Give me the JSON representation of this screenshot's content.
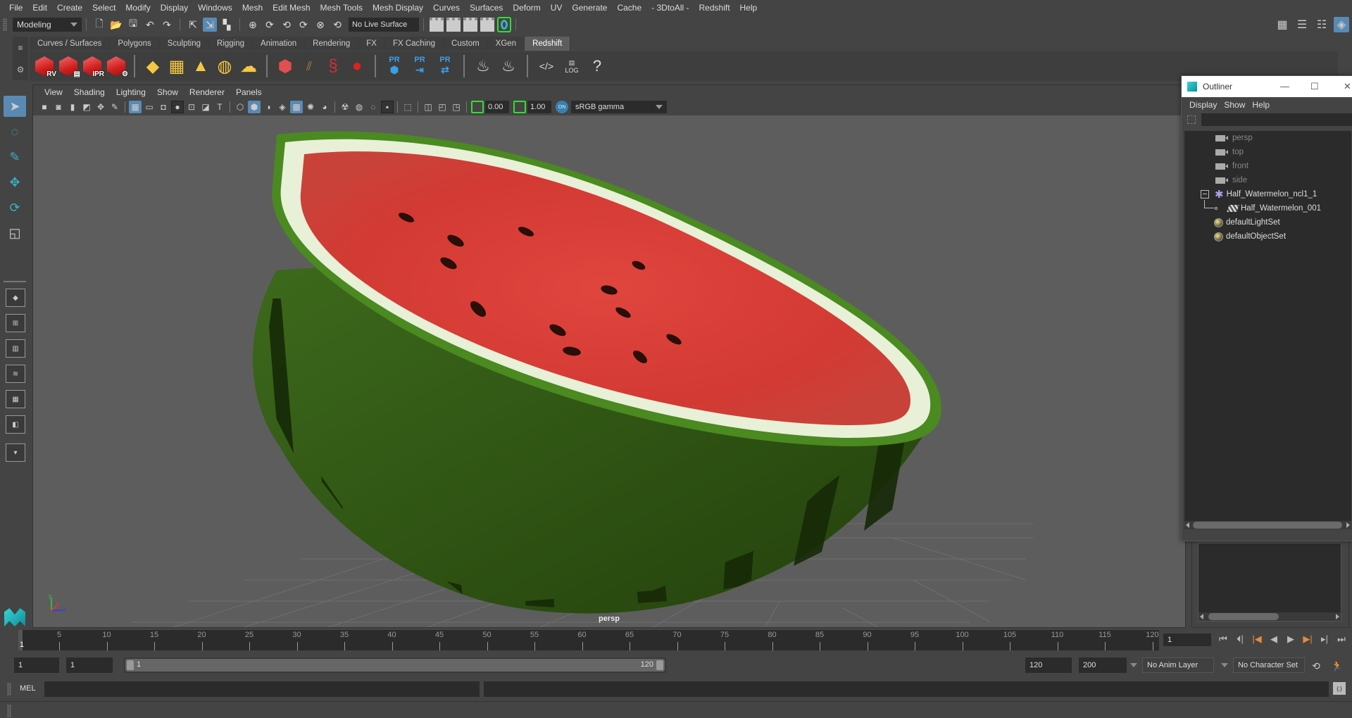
{
  "menubar": {
    "items": [
      "File",
      "Edit",
      "Create",
      "Select",
      "Modify",
      "Display",
      "Windows",
      "Mesh",
      "Edit Mesh",
      "Mesh Tools",
      "Mesh Display",
      "Curves",
      "Surfaces",
      "Deform",
      "UV",
      "Generate",
      "Cache",
      "- 3DtoAll -",
      "Redshift",
      "Help"
    ]
  },
  "statusline": {
    "mode": "Modeling",
    "live_surface": "No Live Surface"
  },
  "shelf": {
    "tabs": [
      "Curves / Surfaces",
      "Polygons",
      "Sculpting",
      "Rigging",
      "Animation",
      "Rendering",
      "FX",
      "FX Caching",
      "Custom",
      "XGen",
      "Redshift"
    ],
    "active_tab": "Redshift",
    "redshift_buttons": [
      "RV",
      "",
      "IPR",
      ""
    ],
    "pr_label": "PR",
    "log_label": "LOG",
    "help_glyph": "?"
  },
  "panel": {
    "menu": [
      "View",
      "Shading",
      "Lighting",
      "Show",
      "Renderer",
      "Panels"
    ],
    "exposure": "0.00",
    "gamma": "1.00",
    "color_space_toggle": "ON",
    "color_space": "sRGB gamma",
    "camera": "persp",
    "axis_labels": {
      "x": "x",
      "y": "y",
      "z": "z"
    }
  },
  "outliner": {
    "title": "Outliner",
    "menu": [
      "Display",
      "Show",
      "Help"
    ],
    "search_value": "",
    "items": [
      {
        "label": "persp",
        "type": "camera",
        "dim": true
      },
      {
        "label": "top",
        "type": "camera",
        "dim": true
      },
      {
        "label": "front",
        "type": "camera",
        "dim": true
      },
      {
        "label": "side",
        "type": "camera",
        "dim": true
      },
      {
        "label": "Half_Watermelon_ncl1_1",
        "type": "group",
        "expanded": true
      },
      {
        "label": "Half_Watermelon_001",
        "type": "mesh",
        "child": true
      },
      {
        "label": "defaultLightSet",
        "type": "set"
      },
      {
        "label": "defaultObjectSet",
        "type": "set"
      }
    ]
  },
  "timeline": {
    "ticks": [
      5,
      10,
      15,
      20,
      25,
      30,
      35,
      40,
      45,
      50,
      55,
      60,
      65,
      70,
      75,
      80,
      85,
      90,
      95,
      100,
      105,
      110,
      115,
      120
    ],
    "current_frame": "1",
    "frame_field": "1"
  },
  "range": {
    "start": "1",
    "playback_start": "1",
    "slider_start": "1",
    "slider_end": "120",
    "playback_end": "120",
    "end": "200",
    "anim_layer": "No Anim Layer",
    "character_set": "No Character Set"
  },
  "cmdline": {
    "label": "MEL",
    "value": ""
  },
  "colors": {
    "accent_blue": "#5a8ab4",
    "active_green": "#2fe02f",
    "playback_orange": "#e68a3c",
    "viewport_bg": "#5d5d5d"
  }
}
